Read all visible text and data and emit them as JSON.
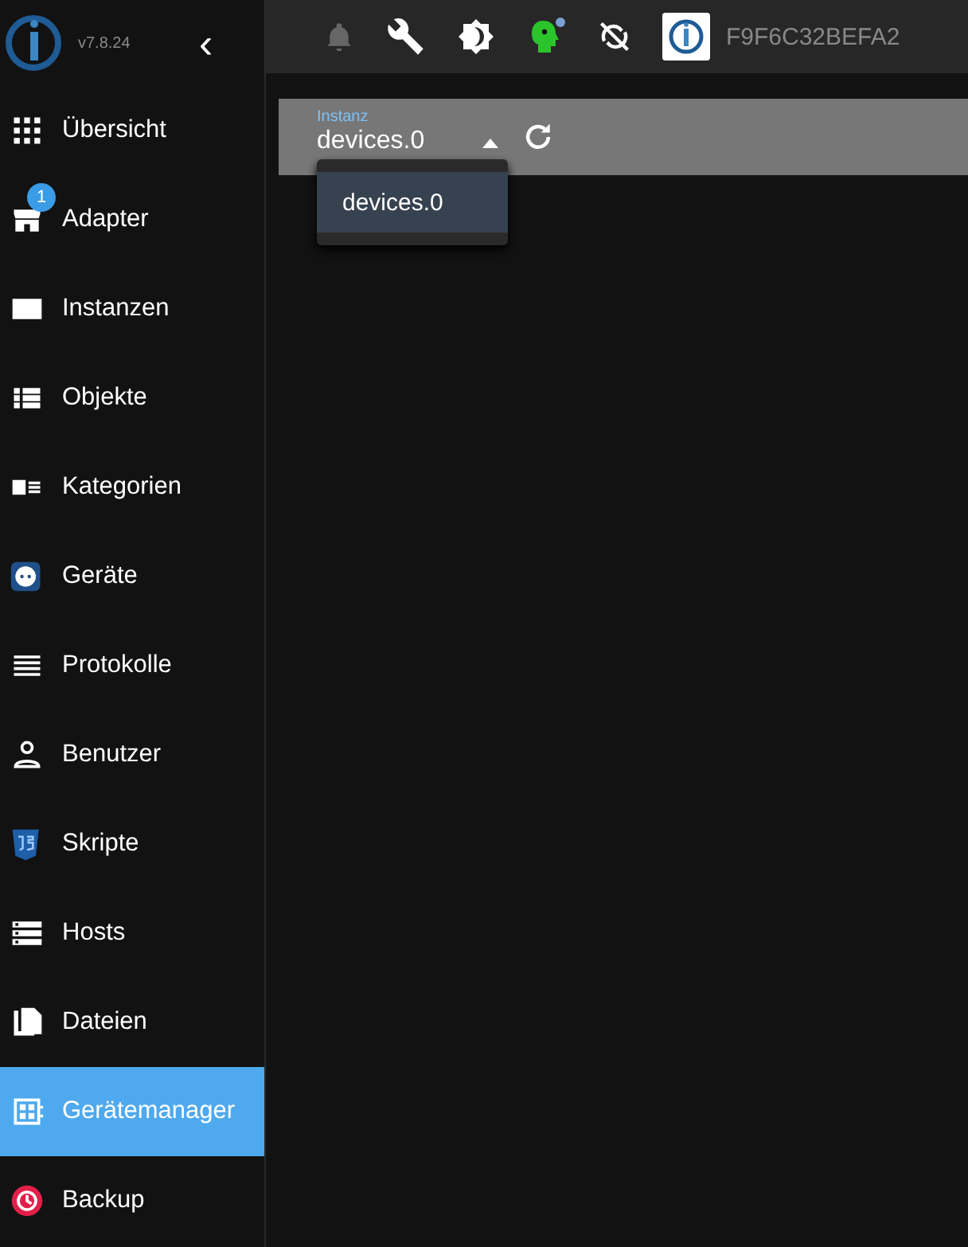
{
  "app": {
    "version": "v7.8.24",
    "collapse_icon": "‹"
  },
  "sidebar": {
    "items": [
      {
        "label": "Übersicht",
        "selected": false
      },
      {
        "label": "Adapter",
        "selected": false,
        "badge": "1"
      },
      {
        "label": "Instanzen",
        "selected": false
      },
      {
        "label": "Objekte",
        "selected": false
      },
      {
        "label": "Kategorien",
        "selected": false
      },
      {
        "label": "Geräte",
        "selected": false
      },
      {
        "label": "Protokolle",
        "selected": false
      },
      {
        "label": "Benutzer",
        "selected": false
      },
      {
        "label": "Skripte",
        "selected": false
      },
      {
        "label": "Hosts",
        "selected": false
      },
      {
        "label": "Dateien",
        "selected": false
      },
      {
        "label": "Gerätemanager",
        "selected": true
      },
      {
        "label": "Backup",
        "selected": false
      }
    ]
  },
  "topbar": {
    "host": "F9F6C32BEFA2"
  },
  "toolbar": {
    "instance_field": {
      "label": "Instanz",
      "value": "devices.0",
      "expanded": true
    }
  },
  "dropdown": {
    "options": [
      {
        "label": "devices.0",
        "selected": true
      }
    ]
  }
}
